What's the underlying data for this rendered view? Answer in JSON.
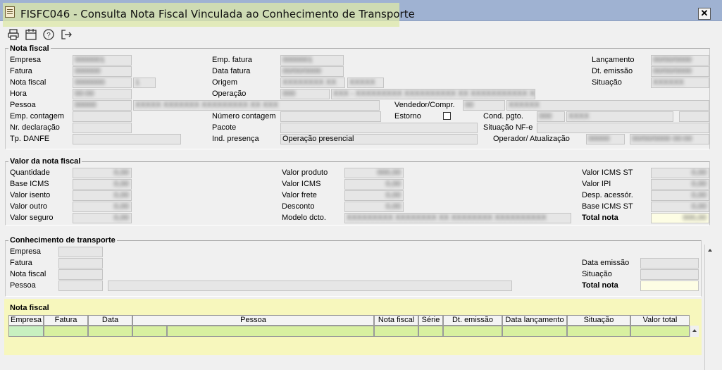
{
  "window": {
    "title": "FISFC046 - Consulta Nota Fiscal Vinculada ao Conhecimento de Transporte",
    "close_label": "✕"
  },
  "toolbar": {
    "icons": [
      "printer-icon",
      "calendar-icon",
      "help-icon",
      "exit-icon"
    ]
  },
  "nota_fiscal": {
    "title": "Nota fiscal",
    "labels": {
      "empresa": "Empresa",
      "fatura": "Fatura",
      "nota_fiscal": "Nota fiscal",
      "hora": "Hora",
      "pessoa": "Pessoa",
      "emp_contagem": "Emp. contagem",
      "nr_declaracao": "Nr. declaração",
      "tp_danfe": "Tp. DANFE",
      "emp_fatura": "Emp. fatura",
      "data_fatura": "Data fatura",
      "origem": "Origem",
      "operacao": "Operação",
      "vendedor": "Vendedor/Compr.",
      "numero_contagem": "Número contagem",
      "estorno": "Estorno",
      "pacote": "Pacote",
      "ind_presenca": "Ind. presença",
      "cond_pgto": "Cond. pgto.",
      "situacao_nfe": "Situação NF-e",
      "operador": "Operador/ Atualização",
      "lancamento": "Lançamento",
      "dt_emissao": "Dt. emissão",
      "situacao": "Situação"
    },
    "values": {
      "empresa": "0000001",
      "fatura": "000000",
      "nota_fiscal": "0000000",
      "nota_fiscal_serie": "1",
      "hora": "00:00",
      "pessoa": "00000",
      "pessoa_nome": "XXXXX XXXXXXX XXXXXXXXX XX XXX",
      "emp_fatura": "0000001",
      "data_fatura": "00/00/0000",
      "origem": "XXXXXXXX XX",
      "origem_extra": "XXXXX",
      "operacao": "000",
      "operacao_desc": "XXX - XXXXXXXXX XXXXXXXXXX XX XXXXXXXXXXX XXX",
      "vendedor": "00",
      "vendedor_nome": "XXXXXX",
      "ind_presenca": "Operação presencial",
      "cond_pgto": "000",
      "cond_pgto_desc": "XXXX",
      "operador": "00000",
      "atualizacao": "00/00/0000 00:00",
      "lancamento": "00/00/0000",
      "dt_emissao": "00/00/0000",
      "situacao": "XXXXXX"
    }
  },
  "valor_nota": {
    "title": "Valor da nota fiscal",
    "labels": {
      "quantidade": "Quantidade",
      "base_icms": "Base ICMS",
      "valor_isento": "Valor isento",
      "valor_outro": "Valor outro",
      "valor_seguro": "Valor seguro",
      "valor_produto": "Valor produto",
      "valor_icms": "Valor ICMS",
      "valor_frete": "Valor frete",
      "desconto": "Desconto",
      "modelo_dcto": "Modelo dcto.",
      "valor_icms_st": "Valor ICMS ST",
      "valor_ipi": "Valor IPI",
      "desp_acessor": "Desp. acessór.",
      "base_icms_st": "Base ICMS ST",
      "total_nota": "Total nota"
    },
    "values": {
      "quantidade": "0,00",
      "base_icms": "0,00",
      "valor_isento": "0,00",
      "valor_outro": "0,00",
      "valor_seguro": "0,00",
      "valor_produto": "000,00",
      "valor_icms": "0,00",
      "valor_frete": "0,00",
      "desconto": "0,00",
      "modelo_dcto": "XXXXXXXXX XXXXXXXX XX XXXXXXXX XXXXXXXXXX",
      "valor_icms_st": "0,00",
      "valor_ipi": "0,00",
      "desp_acessor": "0,00",
      "base_icms_st": "0,00",
      "total_nota": "000,00"
    }
  },
  "conhecimento": {
    "title": "Conhecimento de transporte",
    "labels": {
      "empresa": "Empresa",
      "fatura": "Fatura",
      "nota_fiscal": "Nota fiscal",
      "pessoa": "Pessoa",
      "data_emissao": "Data emissão",
      "situacao": "Situação",
      "total_nota": "Total nota"
    }
  },
  "nf_grid": {
    "title": "Nota fiscal",
    "columns": [
      "Empresa",
      "Fatura",
      "Data",
      "Pessoa",
      "Nota fiscal",
      "Série",
      "Dt. emissão",
      "Data lançamento",
      "Situação",
      "Valor total"
    ]
  }
}
